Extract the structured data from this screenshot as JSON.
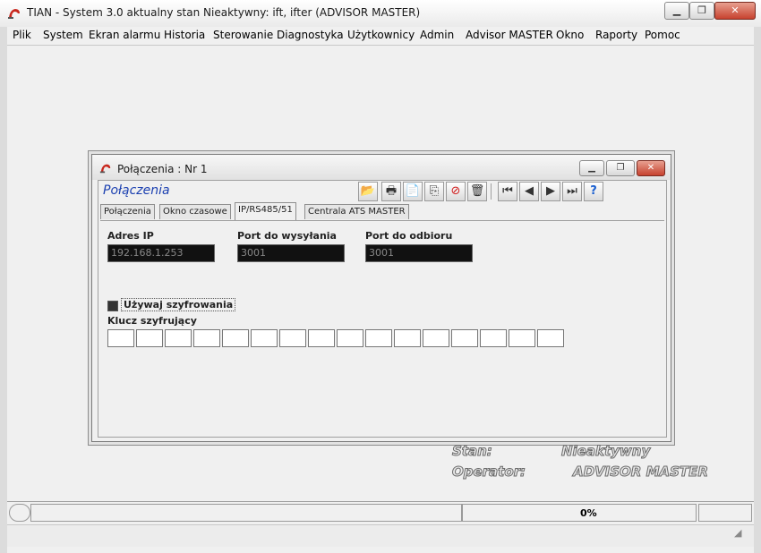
{
  "window": {
    "title": "TIAN - System 3.0 aktualny stan Nieaktywny: ift, ifter (ADVISOR MASTER)",
    "minimize_label": "▁",
    "restore_label": "❐",
    "close_label": "✕"
  },
  "menu": {
    "items": [
      "Plik",
      "System",
      "Ekran alarmu",
      "Historia",
      "Sterowanie",
      "Diagnostyka",
      "Użytkownicy",
      "Admin",
      "Advisor MASTER",
      "Okno",
      "Raporty",
      "Pomoc"
    ]
  },
  "child_window": {
    "title": "Połączenia : Nr 1",
    "heading": "Połączenia",
    "minimize_label": "▁",
    "restore_label": "❐",
    "close_label": "✕",
    "toolbar": [
      {
        "name": "open-icon",
        "glyph": "📂"
      },
      {
        "name": "print-icon",
        "glyph": "🖶"
      },
      {
        "name": "new-document-icon",
        "glyph": "📄"
      },
      {
        "name": "copy-icon",
        "glyph": "⎘"
      },
      {
        "name": "cancel-icon",
        "glyph": "⊘"
      },
      {
        "name": "delete-icon",
        "glyph": "🗑"
      },
      {
        "name": "first-record-icon",
        "glyph": "⏮"
      },
      {
        "name": "previous-record-icon",
        "glyph": "◀"
      },
      {
        "name": "next-record-icon",
        "glyph": "▶"
      },
      {
        "name": "last-record-icon",
        "glyph": "⏭"
      },
      {
        "name": "help-icon",
        "glyph": "?"
      }
    ],
    "tabs": [
      {
        "label": "Połączenia",
        "active": false
      },
      {
        "label": "Okno czasowe",
        "active": false
      },
      {
        "label": "IP/RS485/51",
        "active": true
      },
      {
        "label": "Centrala ATS MASTER",
        "active": false
      }
    ],
    "fields": {
      "ip_label": "Adres IP",
      "ip_value": "192.168.1.253",
      "send_port_label": "Port do wysyłania",
      "send_port_value": "3001",
      "receive_port_label": "Port do odbioru",
      "receive_port_value": "3001"
    },
    "encryption": {
      "checkbox_label": "Używaj szyfrowania",
      "checked": true,
      "key_label": "Klucz szyfrujący",
      "key_cells": [
        "",
        "",
        "",
        "",
        "",
        "",
        "",
        "",
        "",
        "",
        "",
        "",
        "",
        "",
        "",
        ""
      ]
    }
  },
  "status": {
    "state_label": "Stan:",
    "state_value": "Nieaktywny",
    "operator_label": "Operator:",
    "operator_value": "ADVISOR MASTER",
    "progress_text": "0%"
  }
}
